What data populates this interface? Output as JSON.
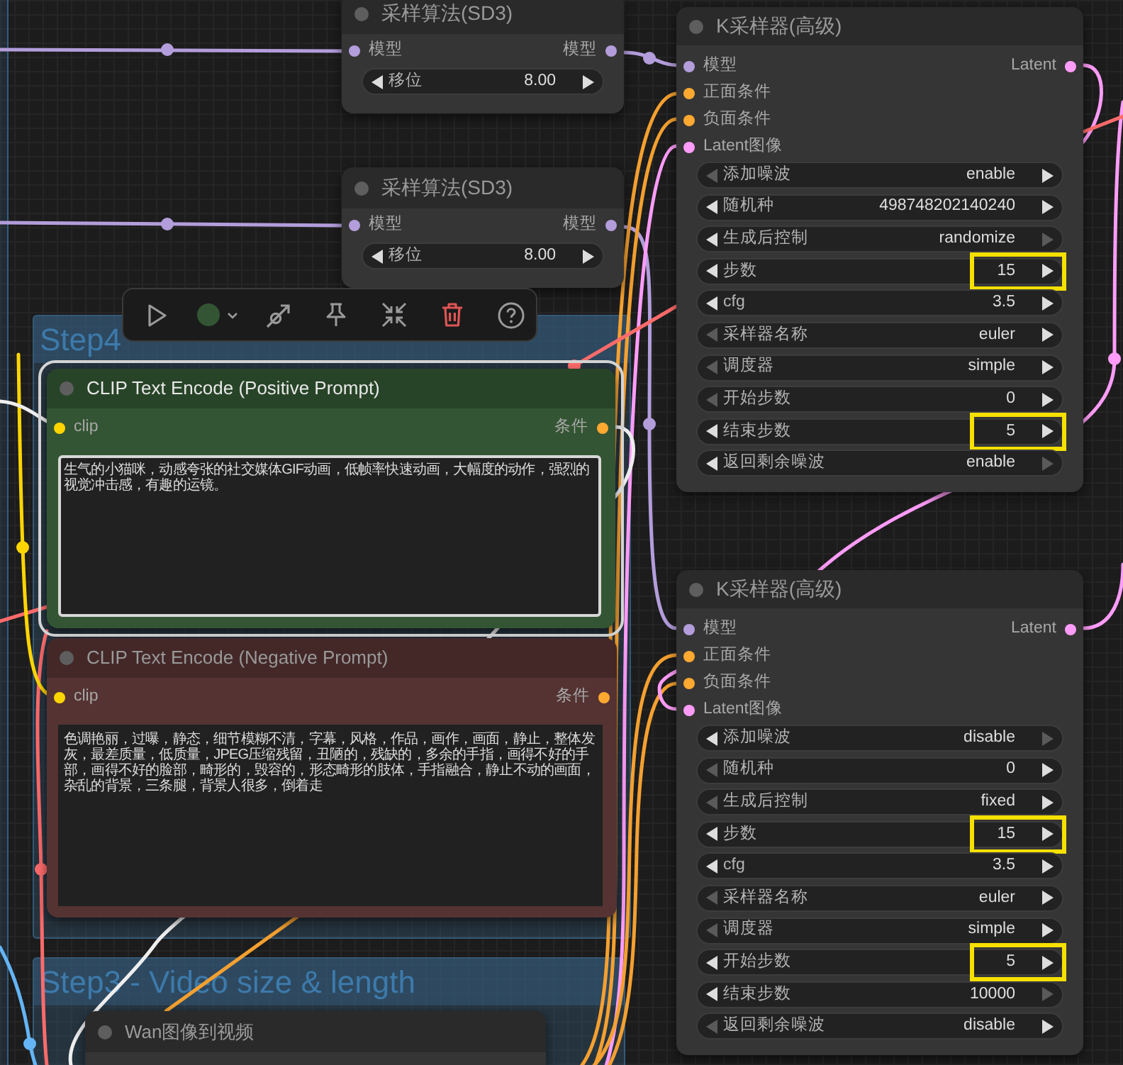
{
  "groups": [
    {
      "title": "Step4"
    },
    {
      "title": "Step3 - Video size & length"
    }
  ],
  "nodes": [
    {
      "kind": "model_sampling",
      "title": "采样算法(SD3)",
      "selected": false,
      "color": "#353535",
      "inputs": [
        {
          "label": "模型",
          "color": "#b39ddb"
        }
      ],
      "outputs": [
        {
          "label": "模型",
          "color": "#b39ddb"
        }
      ],
      "widgets": [
        {
          "label": "移位",
          "value": "8.00",
          "prev_disabled": false,
          "next_disabled": false,
          "highlighted": false
        }
      ]
    },
    {
      "kind": "sampler",
      "title": "K采样器(高级)",
      "selected": false,
      "color": "#353535",
      "inputs": [
        {
          "label": "模型",
          "color": "#b39ddb"
        },
        {
          "label": "正面条件",
          "color": "#ffa931"
        },
        {
          "label": "负面条件",
          "color": "#ffa931"
        },
        {
          "label": "Latent图像",
          "color": "#ff9cf9"
        }
      ],
      "outputs": [
        {
          "label": "Latent",
          "color": "#ff9cf9"
        }
      ],
      "widgets": [
        {
          "label": "添加噪波",
          "value": "enable",
          "prev_disabled": true,
          "next_disabled": false,
          "highlighted": false
        },
        {
          "label": "随机种",
          "value": "498748202140240",
          "prev_disabled": false,
          "next_disabled": false,
          "highlighted": false
        },
        {
          "label": "生成后控制",
          "value": "randomize",
          "prev_disabled": false,
          "next_disabled": true,
          "highlighted": false
        },
        {
          "label": "步数",
          "value": "15",
          "prev_disabled": false,
          "next_disabled": false,
          "highlighted": true
        },
        {
          "label": "cfg",
          "value": "3.5",
          "prev_disabled": false,
          "next_disabled": false,
          "highlighted": false
        },
        {
          "label": "采样器名称",
          "value": "euler",
          "prev_disabled": true,
          "next_disabled": false,
          "highlighted": false
        },
        {
          "label": "调度器",
          "value": "simple",
          "prev_disabled": true,
          "next_disabled": false,
          "highlighted": false
        },
        {
          "label": "开始步数",
          "value": "0",
          "prev_disabled": true,
          "next_disabled": false,
          "highlighted": false
        },
        {
          "label": "结束步数",
          "value": "5",
          "prev_disabled": false,
          "next_disabled": false,
          "highlighted": true
        },
        {
          "label": "返回剩余噪波",
          "value": "enable",
          "prev_disabled": false,
          "next_disabled": true,
          "highlighted": false
        }
      ]
    },
    {
      "kind": "model_sampling",
      "title": "采样算法(SD3)",
      "selected": false,
      "color": "#353535",
      "inputs": [
        {
          "label": "模型",
          "color": "#b39ddb"
        }
      ],
      "outputs": [
        {
          "label": "模型",
          "color": "#b39ddb"
        }
      ],
      "widgets": [
        {
          "label": "移位",
          "value": "8.00",
          "prev_disabled": false,
          "next_disabled": false,
          "highlighted": false
        }
      ]
    },
    {
      "kind": "text_encode",
      "title": "CLIP Text Encode (Positive Prompt)",
      "selected": true,
      "color": "#335533",
      "inputs": [
        {
          "label": "clip",
          "color": "#ffd500"
        }
      ],
      "outputs": [
        {
          "label": "条件",
          "color": "#ffa931"
        }
      ],
      "text": "生气的小猫咪，动感夸张的社交媒体GIF动画，低帧率快速动画，大幅度的动作，强烈的视觉冲击感，有趣的运镜。",
      "focused": true
    },
    {
      "kind": "text_encode",
      "title": "CLIP Text Encode (Negative Prompt)",
      "selected": false,
      "color": "#553333",
      "inputs": [
        {
          "label": "clip",
          "color": "#ffd500"
        }
      ],
      "outputs": [
        {
          "label": "条件",
          "color": "#ffa931"
        }
      ],
      "text": "色调艳丽，过曝，静态，细节模糊不清，字幕，风格，作品，画作，画面，静止，整体发灰，最差质量，低质量，JPEG压缩残留，丑陋的，残缺的，多余的手指，画得不好的手部，画得不好的脸部，畸形的，毁容的，形态畸形的肢体，手指融合，静止不动的画面，杂乱的背景，三条腿，背景人很多，倒着走",
      "focused": false
    },
    {
      "kind": "sampler",
      "title": "K采样器(高级)",
      "selected": false,
      "color": "#353535",
      "inputs": [
        {
          "label": "模型",
          "color": "#b39ddb"
        },
        {
          "label": "正面条件",
          "color": "#ffa931"
        },
        {
          "label": "负面条件",
          "color": "#ffa931"
        },
        {
          "label": "Latent图像",
          "color": "#ff9cf9"
        }
      ],
      "outputs": [
        {
          "label": "Latent",
          "color": "#ff9cf9"
        }
      ],
      "widgets": [
        {
          "label": "添加噪波",
          "value": "disable",
          "prev_disabled": false,
          "next_disabled": true,
          "highlighted": false
        },
        {
          "label": "随机种",
          "value": "0",
          "prev_disabled": true,
          "next_disabled": false,
          "highlighted": false
        },
        {
          "label": "生成后控制",
          "value": "fixed",
          "prev_disabled": true,
          "next_disabled": false,
          "highlighted": false
        },
        {
          "label": "步数",
          "value": "15",
          "prev_disabled": false,
          "next_disabled": false,
          "highlighted": true
        },
        {
          "label": "cfg",
          "value": "3.5",
          "prev_disabled": false,
          "next_disabled": false,
          "highlighted": false
        },
        {
          "label": "采样器名称",
          "value": "euler",
          "prev_disabled": true,
          "next_disabled": false,
          "highlighted": false
        },
        {
          "label": "调度器",
          "value": "simple",
          "prev_disabled": true,
          "next_disabled": false,
          "highlighted": false
        },
        {
          "label": "开始步数",
          "value": "5",
          "prev_disabled": false,
          "next_disabled": false,
          "highlighted": true
        },
        {
          "label": "结束步数",
          "value": "10000",
          "prev_disabled": false,
          "next_disabled": true,
          "highlighted": false
        },
        {
          "label": "返回剩余噪波",
          "value": "disable",
          "prev_disabled": true,
          "next_disabled": false,
          "highlighted": false
        }
      ]
    },
    {
      "kind": "video",
      "title": "Wan图像到视频",
      "selected": false,
      "color": "#353535"
    }
  ]
}
